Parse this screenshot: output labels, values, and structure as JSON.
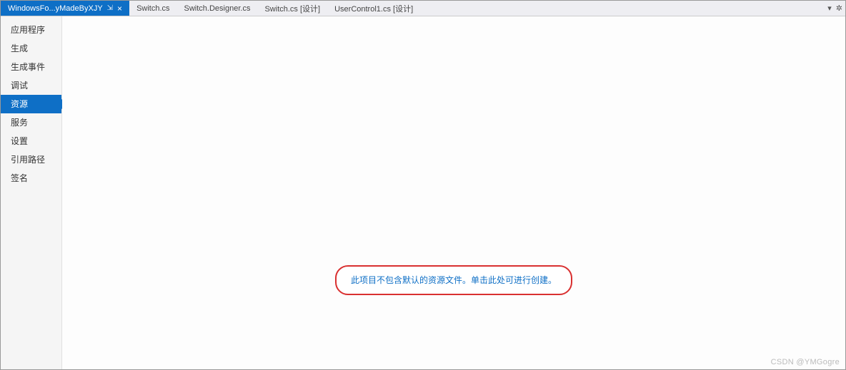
{
  "tabs": [
    {
      "label": "WindowsFo...yMadeByXJY",
      "active": true
    },
    {
      "label": "Switch.cs",
      "active": false
    },
    {
      "label": "Switch.Designer.cs",
      "active": false
    },
    {
      "label": "Switch.cs [设计]",
      "active": false
    },
    {
      "label": "UserControl1.cs [设计]",
      "active": false
    }
  ],
  "sidebar": {
    "items": [
      {
        "label": "应用程序"
      },
      {
        "label": "生成"
      },
      {
        "label": "生成事件"
      },
      {
        "label": "调试"
      },
      {
        "label": "资源",
        "active": true
      },
      {
        "label": "服务"
      },
      {
        "label": "设置"
      },
      {
        "label": "引用路径"
      },
      {
        "label": "签名"
      }
    ]
  },
  "main": {
    "message": "此项目不包含默认的资源文件。单击此处可进行创建。"
  },
  "watermark": "CSDN @YMGogre",
  "icons": {
    "pin": "⇲",
    "close": "×",
    "dropdown": "▾",
    "gear": "✲"
  }
}
